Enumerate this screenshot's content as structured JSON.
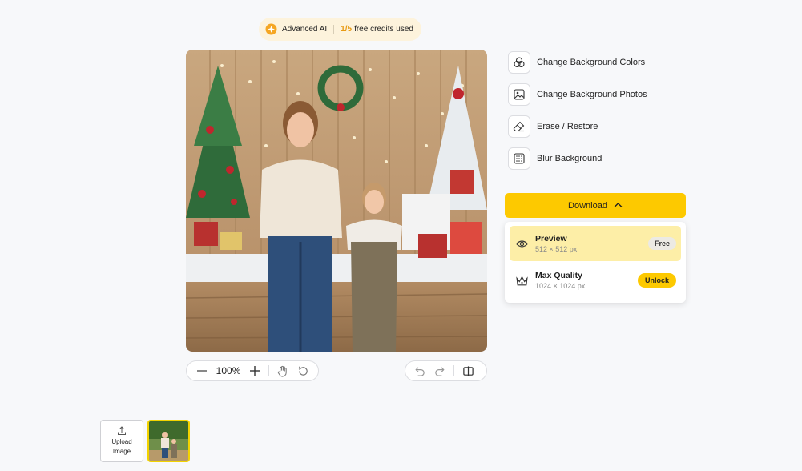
{
  "credits": {
    "icon": "sparkle-icon",
    "label": "Advanced AI",
    "count": "1/5",
    "text": "free credits used"
  },
  "canvas": {
    "image": "edited-photo-christmas-background"
  },
  "zoom_toolbar": {
    "zoom_value": "100%",
    "icons": [
      "zoom-out-icon",
      "zoom-in-icon",
      "hand-pan-icon",
      "reset-icon"
    ]
  },
  "history_toolbar": {
    "icons": [
      "undo-icon",
      "redo-icon",
      "compare-icon"
    ]
  },
  "tools": [
    {
      "label": "Change Background Colors",
      "icon": "palette-circles-icon"
    },
    {
      "label": "Change Background Photos",
      "icon": "image-icon"
    },
    {
      "label": "Erase / Restore",
      "icon": "eraser-icon"
    },
    {
      "label": "Blur Background",
      "icon": "blur-grid-icon"
    }
  ],
  "download": {
    "label": "Download",
    "options": [
      {
        "title": "Preview",
        "subtitle": "512 × 512 px",
        "badge": "Free",
        "icon": "eye-icon"
      },
      {
        "title": "Max Quality",
        "subtitle": "1024 × 1024 px",
        "badge": "Unlock",
        "icon": "crown-icon"
      }
    ]
  },
  "upload": {
    "line1": "Upload",
    "line2": "Image"
  },
  "colors": {
    "accent": "#fdc900",
    "active_option": "#fdeea7",
    "credits_bg": "#fdf3dc",
    "count": "#e89a13"
  }
}
